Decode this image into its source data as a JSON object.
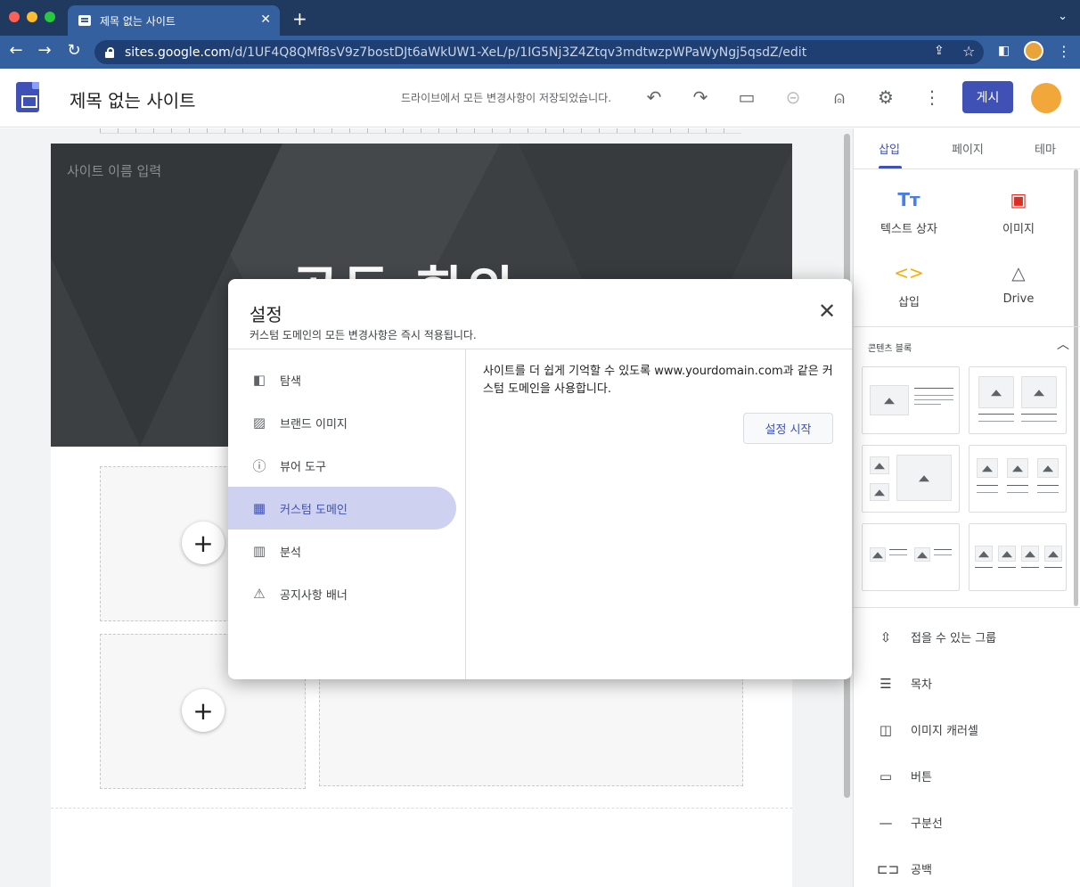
{
  "browser": {
    "tab_title": "제목 없는 사이트",
    "url_domain": "sites.google.com",
    "url_path": "/d/1UF4Q8QMf8sV9z7bostDJt6aWkUW1-XeL/p/1IG5Nj3Z4Ztqv3mdtwzpWPaWyNgj5qsdZ/edit",
    "colors": {
      "tabbar": "#203a5f",
      "toolbar": "#35609f"
    }
  },
  "header": {
    "site_title": "제목 없는 사이트",
    "save_status": "드라이브에서 모든 변경사항이 저장되었습니다.",
    "publish_label": "게시",
    "icons": [
      "undo-icon",
      "redo-icon",
      "preview-devices-icon",
      "link-icon",
      "share-icon",
      "gear-icon",
      "more-vert-icon"
    ]
  },
  "canvas": {
    "site_name_placeholder": "사이트 이름 입력",
    "hero_title": "공동 회의"
  },
  "panel": {
    "tabs": [
      "삽입",
      "페이지",
      "테마"
    ],
    "insert_items": [
      {
        "label": "텍스트 상자",
        "icon": "text-box-icon"
      },
      {
        "label": "이미지",
        "icon": "image-icon"
      },
      {
        "label": "삽입",
        "icon": "embed-code-icon"
      },
      {
        "label": "Drive",
        "icon": "drive-icon"
      }
    ],
    "content_blocks_label": "콘텐츠 블록",
    "list_items": [
      {
        "label": "접을 수 있는 그룹",
        "icon": "collapsible-icon"
      },
      {
        "label": "목차",
        "icon": "toc-icon"
      },
      {
        "label": "이미지 캐러셀",
        "icon": "carousel-icon"
      },
      {
        "label": "버튼",
        "icon": "button-icon"
      },
      {
        "label": "구분선",
        "icon": "divider-icon"
      },
      {
        "label": "공백",
        "icon": "spacer-icon"
      }
    ]
  },
  "modal": {
    "title": "설정",
    "subtitle": "커스텀 도메인의 모든 변경사항은 즉시 적용됩니다.",
    "menu": [
      {
        "label": "탐색",
        "icon": "navigation-icon"
      },
      {
        "label": "브랜드 이미지",
        "icon": "brand-images-icon"
      },
      {
        "label": "뷰어 도구",
        "icon": "info-icon"
      },
      {
        "label": "커스텀 도메인",
        "icon": "domain-icon",
        "active": true
      },
      {
        "label": "분석",
        "icon": "analytics-icon"
      },
      {
        "label": "공지사항 배너",
        "icon": "announcement-icon"
      }
    ],
    "description": "사이트를 더 쉽게 기억할 수 있도록 www.yourdomain.com과 같은 커스텀 도메인을 사용합니다.",
    "setup_button": "설정 시작",
    "accent_color": "#3f51b5"
  }
}
